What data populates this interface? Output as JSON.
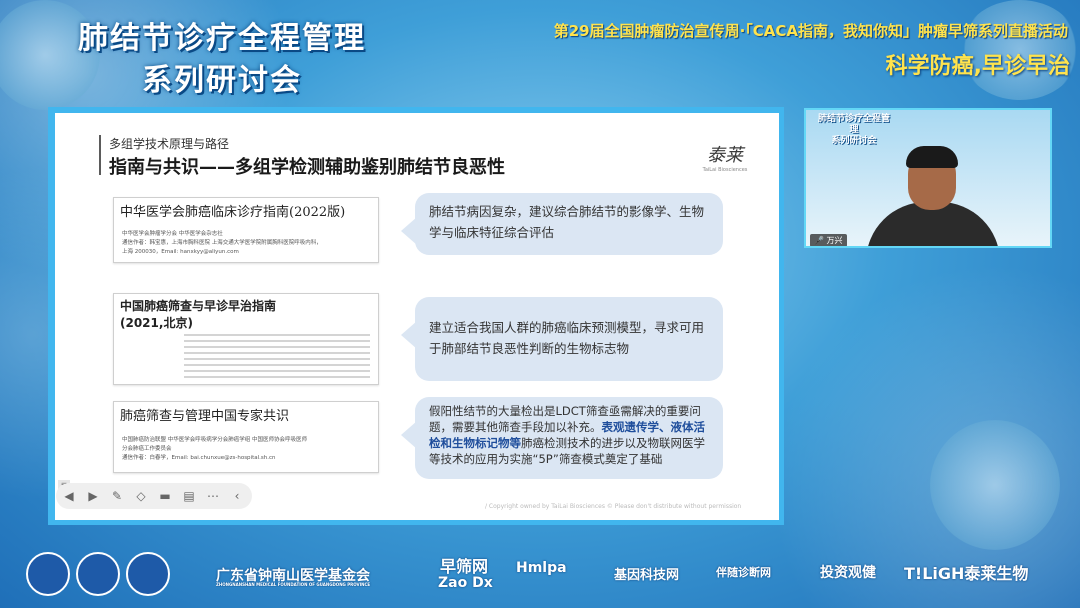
{
  "header": {
    "title_line1": "肺结节诊疗全程管理",
    "title_line2": "系列研讨会",
    "event": "第29届全国肿瘤防治宣传周·「CACA指南，我知你知」肿瘤早筛系列直播活动",
    "slogan": "科学防癌,早诊早治"
  },
  "slide": {
    "kicker": "多组学技术原理与路径",
    "heading": "指南与共识——多组学检测辅助鉴别肺结节良恶性",
    "brand": "泰莱",
    "brand_sub": "TaiLai Biosciences",
    "cards": [
      {
        "title": "中华医学会肺癌临床诊疗指南(2022版)",
        "fine": [
          "中华医学会肿瘤学分会   中华医学会杂志社",
          "通信作者：韩宝惠，上海市胸科医院 上海交通大学医学院附属胸科医院呼吸内科，",
          "上海 200030，Email: hanxkyy@aliyun.com"
        ]
      },
      {
        "title": "中国肺癌筛查与早诊早治指南",
        "title2": "(2021,北京)",
        "fine": []
      },
      {
        "title": "肺癌筛查与管理中国专家共识",
        "fine": [
          "中国肺癌防治联盟   中华医学会呼吸病学分会肺癌学组   中国医师协会呼吸医师",
          "分会肺癌工作委员会",
          "通信作者：白春学，Email: bai.chunxue@zs-hospital.sh.cn"
        ]
      }
    ],
    "bubbles": [
      {
        "text": "肺结节病因复杂，建议综合肺结节的影像学、生物学与临床特征综合评估"
      },
      {
        "text": "建立适合我国人群的肺癌临床预测模型，寻求可用于肺部结节良恶性判断的生物标志物"
      },
      {
        "text_a": "假阳性结节的大量检出是LDCT筛查亟需解决的重要问题，需要其他筛查手段加以补充。",
        "text_hl": "表观遗传学、液体活检和生物标记物等",
        "text_b": "肺癌检测技术的进步以及物联网医学等技术的应用为实施“5P”筛查模式奠定了基础"
      }
    ],
    "copyright": "/ Copyright owned by TaiLai Biosciences © Please don't distribute without permission"
  },
  "video": {
    "title_line1": "肺结节诊疗全程管理",
    "title_line2": "系列研讨会",
    "speaker": "万兴"
  },
  "footer": {
    "foundation": "广东省钟南山医学基金会",
    "foundation_en": "ZHONGNANSHAN MEDICAL FOUNDATION OF GUANGDONG PROVINCE",
    "zaoshai": "早筛网",
    "zaodx": "Zao Dx",
    "hmlpa": "Hmlpa",
    "jiyin": "基因科技网",
    "banshui": "伴随诊断网",
    "touzi": "投资观健",
    "tailai": "T!LiGH泰莱生物"
  },
  "colors": {
    "accent": "#ffe34d",
    "frame": "#41b6ee",
    "bubble": "#dbe6f3",
    "highlight": "#1f4e9c"
  }
}
